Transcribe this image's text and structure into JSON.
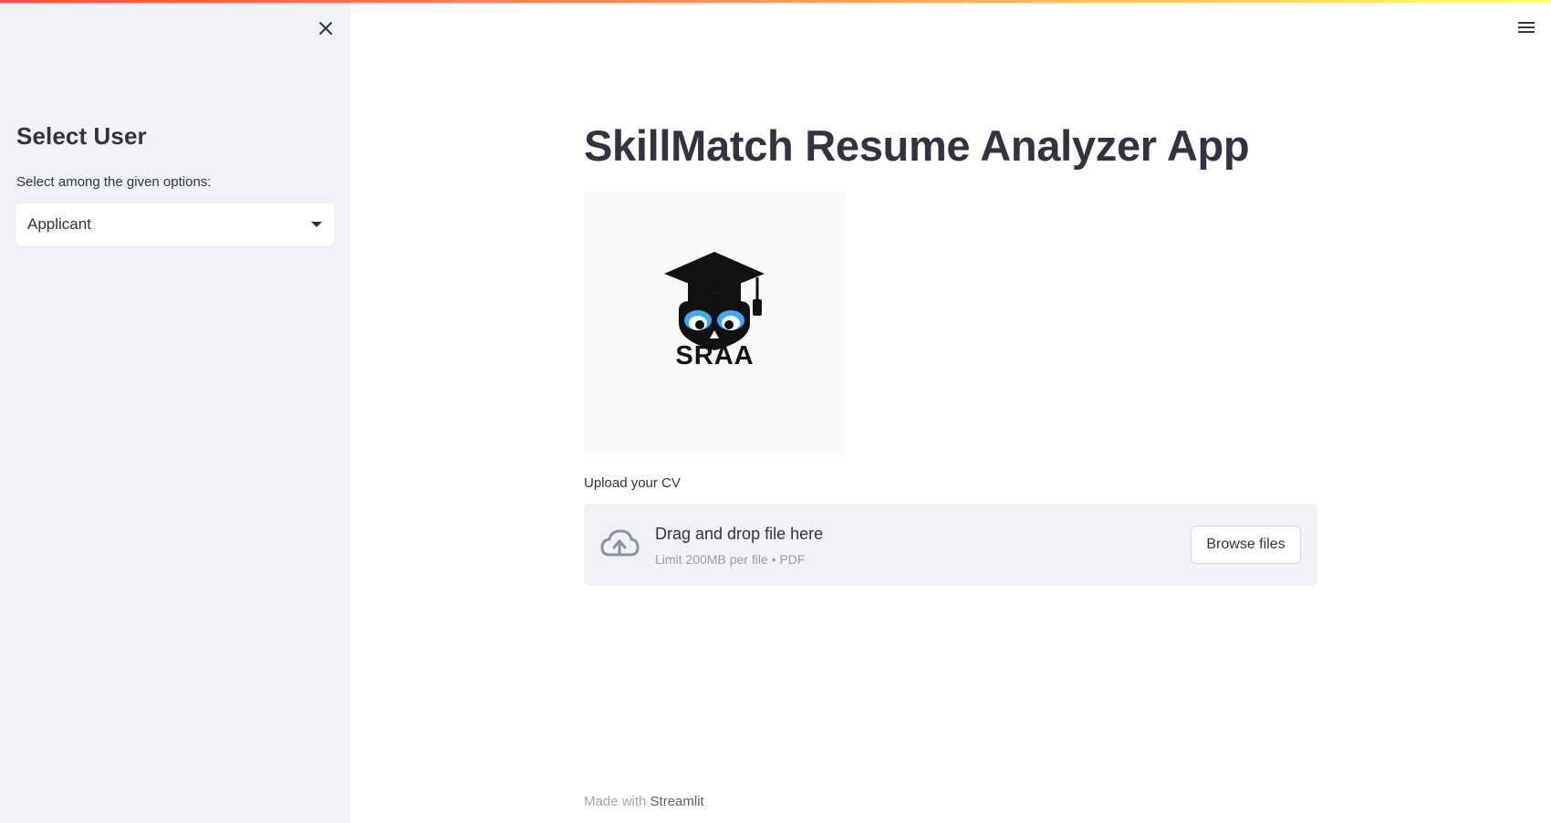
{
  "sidebar": {
    "close_icon": "close-icon",
    "title": "Select User",
    "select_label": "Select among the given options:",
    "select_value": "Applicant",
    "select_arrow_icon": "caret-down-icon"
  },
  "header": {
    "menu_icon": "hamburger-menu-icon"
  },
  "main": {
    "title": "SkillMatch Resume Analyzer App",
    "logo_text": "SRAA",
    "logo_icon": "owl-graduation-cap-logo",
    "uploader": {
      "label": "Upload your CV",
      "drop_title": "Drag and drop file here",
      "drop_limit": "Limit 200MB per file • PDF",
      "browse_label": "Browse files",
      "cloud_icon": "cloud-upload-icon"
    }
  },
  "footer": {
    "prefix": "Made with",
    "link": "Streamlit"
  },
  "colors": {
    "sidebar_bg": "#f0f2f6",
    "text": "#31333f",
    "dropzone_bg": "#f0f2f6",
    "accent_gradient_start": "#ff4b4b",
    "accent_gradient_end": "#fffd80",
    "icon_blue": "#3fa9f5"
  }
}
